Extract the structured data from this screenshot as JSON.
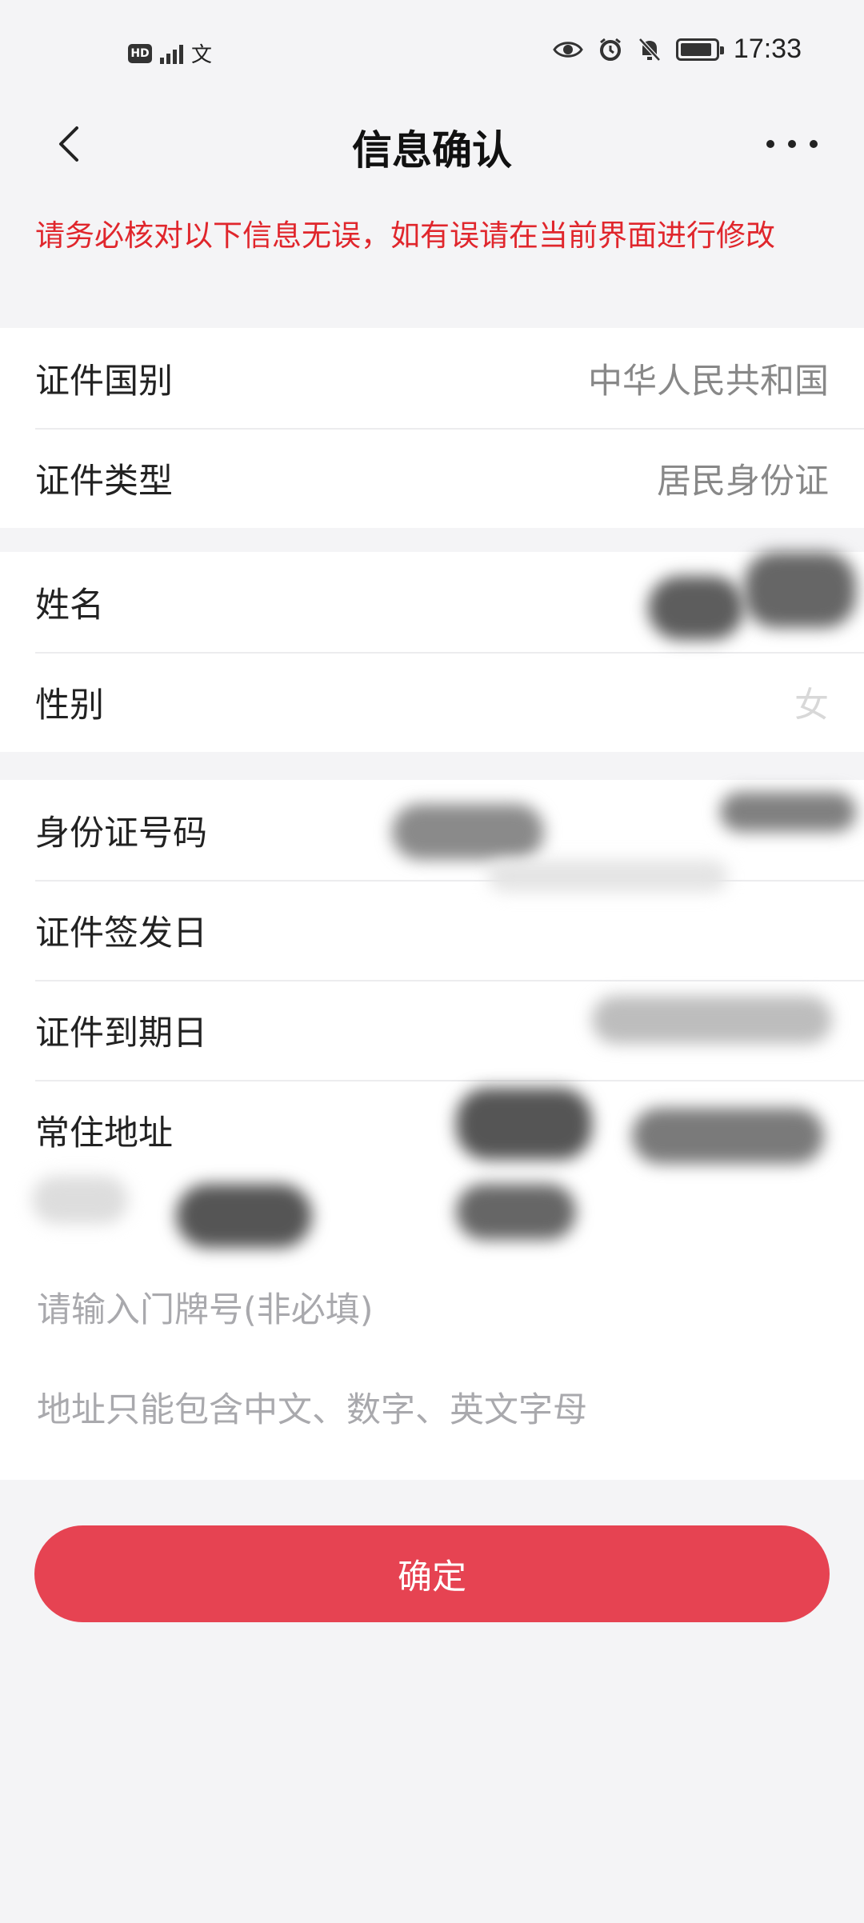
{
  "status_bar": {
    "hd_label": "HD",
    "carrier_glyph": "文",
    "time": "17:33"
  },
  "nav": {
    "title": "信息确认"
  },
  "warning_text": "请务必核对以下信息无误，如有误请在当前界面进行修改",
  "document_group": [
    {
      "label": "证件国别",
      "value": "中华人民共和国"
    },
    {
      "label": "证件类型",
      "value": "居民身份证"
    }
  ],
  "personal_group": [
    {
      "label": "姓名",
      "value": ""
    },
    {
      "label": "性别",
      "value": "女"
    }
  ],
  "id_group": [
    {
      "label": "身份证号码",
      "value": ""
    },
    {
      "label": "证件签发日",
      "value": ""
    },
    {
      "label": "证件到期日",
      "value": ""
    },
    {
      "label": "常住地址",
      "value": ""
    }
  ],
  "address": {
    "house_number_placeholder": "请输入门牌号(非必填)",
    "hint_placeholder": "地址只能包含中文、数字、英文字母"
  },
  "confirm_label": "确定",
  "colors": {
    "warning": "#e0262c",
    "button": "#e64352",
    "background": "#f4f4f6"
  }
}
